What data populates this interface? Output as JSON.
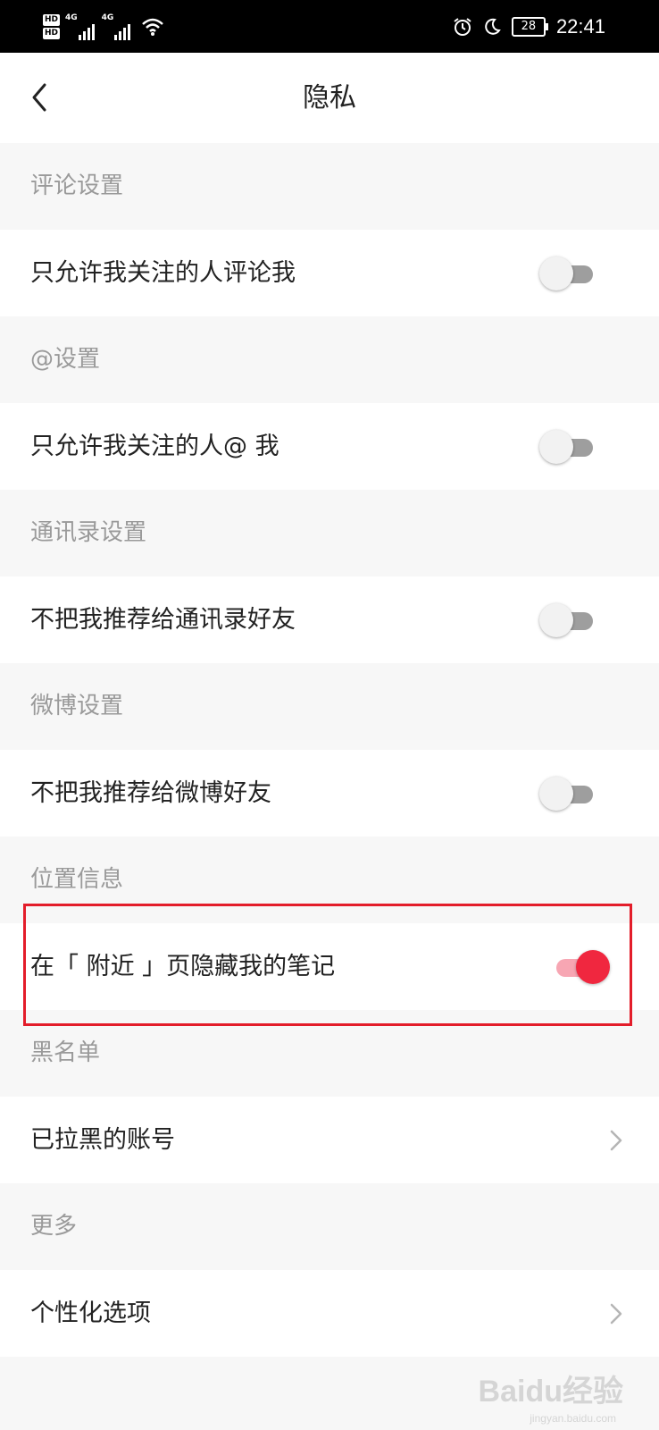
{
  "status_bar": {
    "hd1": "HD",
    "hd2": "HD",
    "net1": "4G",
    "net2": "4G",
    "battery": "28",
    "time": "22:41"
  },
  "nav": {
    "title": "隐私"
  },
  "sections": [
    {
      "header": "评论设置",
      "item": "只允许我关注的人评论我",
      "control": "toggle",
      "on": false
    },
    {
      "header": "@设置",
      "item": "只允许我关注的人@ 我",
      "control": "toggle",
      "on": false
    },
    {
      "header": "通讯录设置",
      "item": "不把我推荐给通讯录好友",
      "control": "toggle",
      "on": false
    },
    {
      "header": "微博设置",
      "item": "不把我推荐给微博好友",
      "control": "toggle",
      "on": false
    },
    {
      "header": "位置信息",
      "item": "在「 附近 」页隐藏我的笔记",
      "control": "toggle",
      "on": true
    },
    {
      "header": "黑名单",
      "item": "已拉黑的账号",
      "control": "chevron"
    },
    {
      "header": "更多",
      "item": "个性化选项",
      "control": "chevron"
    }
  ],
  "watermark": {
    "main": "Baidu经验",
    "sub": "jingyan.baidu.com"
  },
  "colors": {
    "toggle_on": "#f0273f",
    "toggle_on_track": "#f7a6b3",
    "toggle_off_track": "#9e9e9e",
    "highlight": "#e31d2a"
  }
}
